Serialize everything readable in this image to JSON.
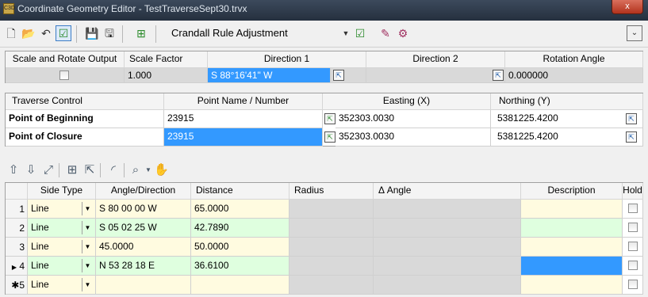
{
  "window": {
    "title": "Coordinate Geometry Editor - TestTraverseSept30.trvx",
    "app_icon": "C3D",
    "close_label": "x"
  },
  "toolbar": {
    "adjustment_method": "Crandall Rule Adjustment",
    "icons": [
      "new-icon",
      "open-icon",
      "undo-icon",
      "checkbox-icon",
      "save-icon",
      "save-as-icon",
      "edit-icon",
      "check-icon",
      "draw-icon",
      "settings-icon",
      "collapse-icon"
    ]
  },
  "scale_panel": {
    "headers": [
      "Scale and Rotate Output",
      "Scale Factor",
      "Direction 1",
      "Direction 2",
      "Rotation Angle"
    ],
    "scale_factor": "1.000",
    "direction1": "S 88°16'41\" W",
    "direction2": "",
    "rotation_angle": "0.000000"
  },
  "traverse_panel": {
    "headers": [
      "Traverse Control",
      "Point Name / Number",
      "Easting (X)",
      "Northing (Y)"
    ],
    "rows": [
      {
        "label": "Point of Beginning",
        "point": "23915",
        "easting": "352303.0030",
        "northing": "5381225.4200"
      },
      {
        "label": "Point of Closure",
        "point": "23915",
        "easting": "352303.0030",
        "northing": "5381225.4200"
      }
    ]
  },
  "grid": {
    "headers": [
      "Side Type",
      "Angle/Direction",
      "Distance",
      "Radius",
      "Δ Angle",
      "Description",
      "Hold"
    ],
    "rows": [
      {
        "num": "1",
        "type": "Line",
        "angle": "S 80 00 00 W",
        "distance": "65.0000"
      },
      {
        "num": "2",
        "type": "Line",
        "angle": "S 05 02 25 W",
        "distance": "42.7890"
      },
      {
        "num": "3",
        "type": "Line",
        "angle": "45.0000",
        "distance": "50.0000"
      },
      {
        "num": "4",
        "type": "Line",
        "angle": "N 53 28 18 E",
        "distance": "36.6100"
      },
      {
        "num": "5",
        "type": "Line",
        "angle": "",
        "distance": ""
      }
    ],
    "current_marker": "▶",
    "new_marker": "✱"
  },
  "colors": {
    "selection": "#3399ff",
    "green_row": "#dfffdf",
    "yellow_cell": "#fffbe0"
  }
}
